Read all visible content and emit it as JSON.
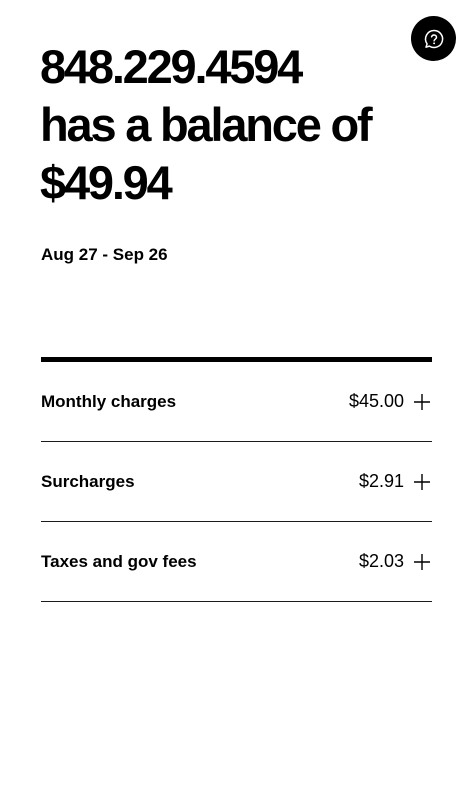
{
  "help": {
    "icon": "help-chat-icon"
  },
  "balance": {
    "line1": "848.229.4594",
    "line2": "has a balance of",
    "line3": "$49.94"
  },
  "billing_period": "Aug 27 - Sep 26",
  "charges": [
    {
      "label": "Monthly charges",
      "amount": "$45.00",
      "icon": "plus-icon"
    },
    {
      "label": "Surcharges",
      "amount": "$2.91",
      "icon": "plus-icon"
    },
    {
      "label": "Taxes and gov fees",
      "amount": "$2.03",
      "icon": "plus-icon"
    }
  ],
  "colors": {
    "text": "#000000",
    "background": "#ffffff",
    "help_button_bg": "#000000"
  }
}
